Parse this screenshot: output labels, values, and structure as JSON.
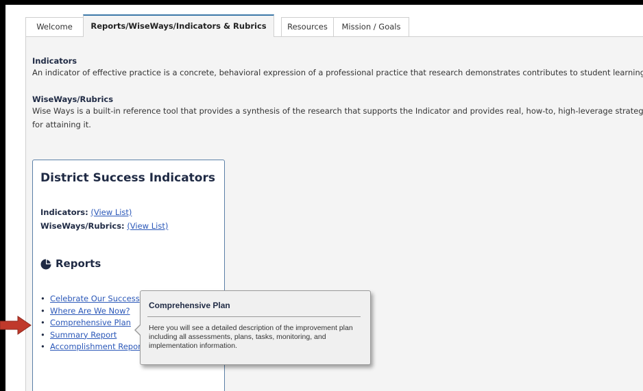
{
  "tabs": [
    {
      "label": "Welcome",
      "active": false
    },
    {
      "label": "Reports/WiseWays/Indicators & Rubrics",
      "active": true
    },
    {
      "label": "Resources",
      "active": false
    },
    {
      "label": "Mission / Goals",
      "active": false
    }
  ],
  "indicators_section": {
    "title": "Indicators",
    "text": "An indicator of effective practice is a concrete, behavioral expression of a professional practice that research demonstrates contributes to student learning."
  },
  "wiseways_section": {
    "title": "WiseWays/Rubrics",
    "text_line1": "Wise Ways is a built-in reference tool that provides a synthesis of the research that supports the Indicator and provides real, how-to, high-leverage strategies",
    "text_line2": "for attaining it."
  },
  "card": {
    "title": "District Success Indicators",
    "indicators_label": "Indicators:",
    "indicators_link": "(View List)",
    "wiseways_label": "WiseWays/Rubrics:",
    "wiseways_link": "(View List)",
    "reports_heading": "Reports",
    "reports_icon": "pie-chart-icon",
    "reports": [
      {
        "label": "Celebrate Our Success"
      },
      {
        "label": "Where Are We Now?"
      },
      {
        "label": "Comprehensive Plan"
      },
      {
        "label": "Summary Report"
      },
      {
        "label": "Accomplishment Report"
      }
    ]
  },
  "tooltip": {
    "title": "Comprehensive Plan",
    "body": "Here you will see a detailed description of the improvement plan including all assessments, plans, tasks, monitoring, and implementation information."
  },
  "colors": {
    "accent": "#3b78a8",
    "link": "#2a57b8",
    "heading": "#1f2a44",
    "annotation_arrow": "#c0392b"
  },
  "annotation": {
    "icon": "red-arrow-icon"
  }
}
